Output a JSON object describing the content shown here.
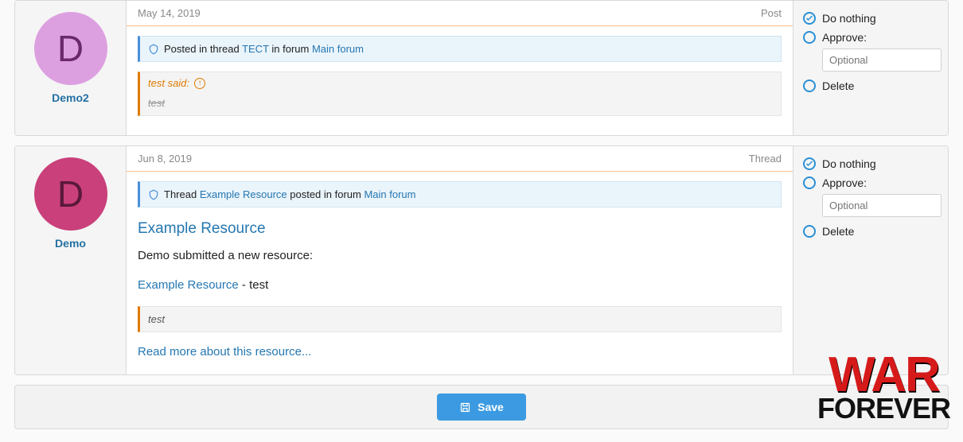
{
  "items": [
    {
      "user": {
        "initial": "D",
        "name": "Demo2",
        "avatar_class": "pink-light"
      },
      "date": "May 14, 2019",
      "type_label": "Post",
      "notice": {
        "prefix": "Posted in thread ",
        "thread": "TECT",
        "mid": " in forum ",
        "forum": "Main forum"
      },
      "quote": {
        "head": "test said:",
        "body": "test"
      },
      "actions": {
        "do_nothing": "Do nothing",
        "approve": "Approve:",
        "optional_placeholder": "Optional",
        "delete": "Delete"
      }
    },
    {
      "user": {
        "initial": "D",
        "name": "Demo",
        "avatar_class": "pink-dark"
      },
      "date": "Jun 8, 2019",
      "type_label": "Thread",
      "notice": {
        "prefix": "Thread ",
        "thread": "Example Resource",
        "mid": " posted in forum ",
        "forum": "Main forum"
      },
      "title": "Example Resource",
      "body_line1": "Demo submitted a new resource:",
      "body_link": "Example Resource",
      "body_suffix": " - test",
      "quote_plain": "test",
      "read_more": "Read more about this resource...",
      "actions": {
        "do_nothing": "Do nothing",
        "approve": "Approve:",
        "optional_placeholder": "Optional",
        "delete": "Delete"
      }
    }
  ],
  "save_label": "Save",
  "logo": {
    "line1": "WAR",
    "line2": "FOREVER"
  }
}
